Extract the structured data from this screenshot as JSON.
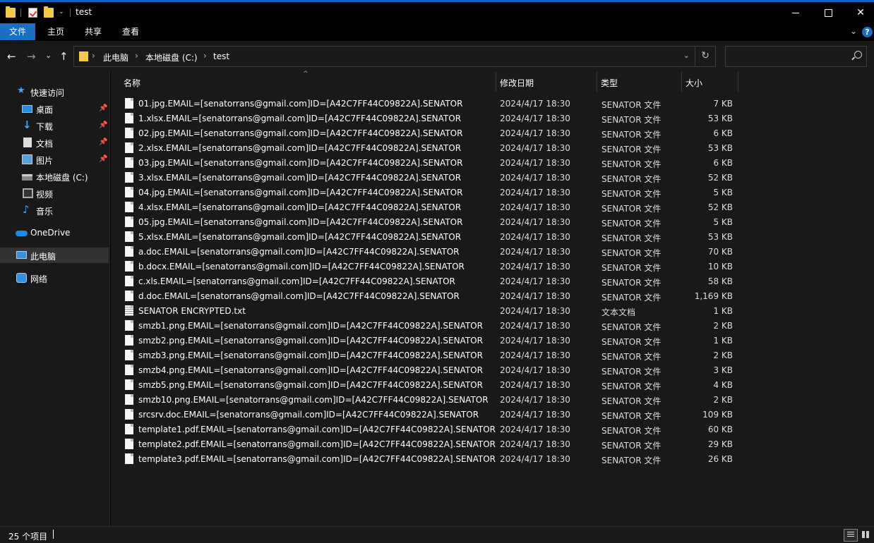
{
  "window": {
    "title": "test",
    "close_glyph": "✕",
    "chevron_glyph": "⌄",
    "help_glyph": "?"
  },
  "ribbon": {
    "tabs": [
      {
        "label": "文件",
        "active": true
      },
      {
        "label": "主页"
      },
      {
        "label": "共享"
      },
      {
        "label": "查看"
      }
    ]
  },
  "nav": {
    "back_glyph": "←",
    "forward_glyph": "→",
    "recent_glyph": "⌄",
    "up_glyph": "↑"
  },
  "address": {
    "crumbs": [
      "此电脑",
      "本地磁盘 (C:)",
      "test"
    ],
    "separator": "›",
    "dropdown_glyph": "⌄",
    "refresh_glyph": "↻"
  },
  "search": {
    "placeholder": "",
    "value": ""
  },
  "sidebar": {
    "pin_glyph": "📌",
    "items": [
      {
        "label": "快速访问",
        "icon": "star-icon",
        "glyph": "★"
      },
      {
        "label": "桌面",
        "icon": "desktop-icon",
        "pinned": true
      },
      {
        "label": "下载",
        "icon": "download-icon",
        "glyph": "↓",
        "pinned": true
      },
      {
        "label": "文档",
        "icon": "document-icon",
        "pinned": true
      },
      {
        "label": "图片",
        "icon": "pictures-icon",
        "pinned": true
      },
      {
        "label": "本地磁盘 (C:)",
        "icon": "drive-icon"
      },
      {
        "label": "视频",
        "icon": "video-icon"
      },
      {
        "label": "音乐",
        "icon": "music-icon",
        "glyph": "♪"
      },
      {
        "label": "OneDrive",
        "icon": "cloud-icon"
      },
      {
        "label": "此电脑",
        "icon": "computer-icon",
        "selected": true
      },
      {
        "label": "网络",
        "icon": "network-icon"
      }
    ]
  },
  "file_list": {
    "sort_glyph": "^",
    "columns": {
      "name": "名称",
      "modified": "修改日期",
      "type": "类型",
      "size": "大小"
    },
    "rows": [
      {
        "name": "01.jpg.EMAIL=[senatorrans@gmail.com]ID=[A42C7FF44C09822A].SENATOR",
        "modified": "2024/4/17 18:30",
        "type": "SENATOR 文件",
        "size": "7 KB"
      },
      {
        "name": "1.xlsx.EMAIL=[senatorrans@gmail.com]ID=[A42C7FF44C09822A].SENATOR",
        "modified": "2024/4/17 18:30",
        "type": "SENATOR 文件",
        "size": "53 KB"
      },
      {
        "name": "02.jpg.EMAIL=[senatorrans@gmail.com]ID=[A42C7FF44C09822A].SENATOR",
        "modified": "2024/4/17 18:30",
        "type": "SENATOR 文件",
        "size": "6 KB"
      },
      {
        "name": "2.xlsx.EMAIL=[senatorrans@gmail.com]ID=[A42C7FF44C09822A].SENATOR",
        "modified": "2024/4/17 18:30",
        "type": "SENATOR 文件",
        "size": "53 KB"
      },
      {
        "name": "03.jpg.EMAIL=[senatorrans@gmail.com]ID=[A42C7FF44C09822A].SENATOR",
        "modified": "2024/4/17 18:30",
        "type": "SENATOR 文件",
        "size": "6 KB"
      },
      {
        "name": "3.xlsx.EMAIL=[senatorrans@gmail.com]ID=[A42C7FF44C09822A].SENATOR",
        "modified": "2024/4/17 18:30",
        "type": "SENATOR 文件",
        "size": "52 KB"
      },
      {
        "name": "04.jpg.EMAIL=[senatorrans@gmail.com]ID=[A42C7FF44C09822A].SENATOR",
        "modified": "2024/4/17 18:30",
        "type": "SENATOR 文件",
        "size": "5 KB"
      },
      {
        "name": "4.xlsx.EMAIL=[senatorrans@gmail.com]ID=[A42C7FF44C09822A].SENATOR",
        "modified": "2024/4/17 18:30",
        "type": "SENATOR 文件",
        "size": "52 KB"
      },
      {
        "name": "05.jpg.EMAIL=[senatorrans@gmail.com]ID=[A42C7FF44C09822A].SENATOR",
        "modified": "2024/4/17 18:30",
        "type": "SENATOR 文件",
        "size": "5 KB"
      },
      {
        "name": "5.xlsx.EMAIL=[senatorrans@gmail.com]ID=[A42C7FF44C09822A].SENATOR",
        "modified": "2024/4/17 18:30",
        "type": "SENATOR 文件",
        "size": "53 KB"
      },
      {
        "name": "a.doc.EMAIL=[senatorrans@gmail.com]ID=[A42C7FF44C09822A].SENATOR",
        "modified": "2024/4/17 18:30",
        "type": "SENATOR 文件",
        "size": "70 KB"
      },
      {
        "name": "b.docx.EMAIL=[senatorrans@gmail.com]ID=[A42C7FF44C09822A].SENATOR",
        "modified": "2024/4/17 18:30",
        "type": "SENATOR 文件",
        "size": "10 KB"
      },
      {
        "name": "c.xls.EMAIL=[senatorrans@gmail.com]ID=[A42C7FF44C09822A].SENATOR",
        "modified": "2024/4/17 18:30",
        "type": "SENATOR 文件",
        "size": "58 KB"
      },
      {
        "name": "d.doc.EMAIL=[senatorrans@gmail.com]ID=[A42C7FF44C09822A].SENATOR",
        "modified": "2024/4/17 18:30",
        "type": "SENATOR 文件",
        "size": "1,169 KB"
      },
      {
        "name": "SENATOR ENCRYPTED.txt",
        "modified": "2024/4/17 18:30",
        "type": "文本文档",
        "size": "1 KB",
        "icon": "text-file-icon"
      },
      {
        "name": "smzb1.png.EMAIL=[senatorrans@gmail.com]ID=[A42C7FF44C09822A].SENATOR",
        "modified": "2024/4/17 18:30",
        "type": "SENATOR 文件",
        "size": "2 KB"
      },
      {
        "name": "smzb2.png.EMAIL=[senatorrans@gmail.com]ID=[A42C7FF44C09822A].SENATOR",
        "modified": "2024/4/17 18:30",
        "type": "SENATOR 文件",
        "size": "1 KB"
      },
      {
        "name": "smzb3.png.EMAIL=[senatorrans@gmail.com]ID=[A42C7FF44C09822A].SENATOR",
        "modified": "2024/4/17 18:30",
        "type": "SENATOR 文件",
        "size": "2 KB"
      },
      {
        "name": "smzb4.png.EMAIL=[senatorrans@gmail.com]ID=[A42C7FF44C09822A].SENATOR",
        "modified": "2024/4/17 18:30",
        "type": "SENATOR 文件",
        "size": "3 KB"
      },
      {
        "name": "smzb5.png.EMAIL=[senatorrans@gmail.com]ID=[A42C7FF44C09822A].SENATOR",
        "modified": "2024/4/17 18:30",
        "type": "SENATOR 文件",
        "size": "4 KB"
      },
      {
        "name": "smzb10.png.EMAIL=[senatorrans@gmail.com]ID=[A42C7FF44C09822A].SENATOR",
        "modified": "2024/4/17 18:30",
        "type": "SENATOR 文件",
        "size": "2 KB"
      },
      {
        "name": "srcsrv.doc.EMAIL=[senatorrans@gmail.com]ID=[A42C7FF44C09822A].SENATOR",
        "modified": "2024/4/17 18:30",
        "type": "SENATOR 文件",
        "size": "109 KB"
      },
      {
        "name": "template1.pdf.EMAIL=[senatorrans@gmail.com]ID=[A42C7FF44C09822A].SENATOR",
        "modified": "2024/4/17 18:30",
        "type": "SENATOR 文件",
        "size": "60 KB"
      },
      {
        "name": "template2.pdf.EMAIL=[senatorrans@gmail.com]ID=[A42C7FF44C09822A].SENATOR",
        "modified": "2024/4/17 18:30",
        "type": "SENATOR 文件",
        "size": "29 KB"
      },
      {
        "name": "template3.pdf.EMAIL=[senatorrans@gmail.com]ID=[A42C7FF44C09822A].SENATOR",
        "modified": "2024/4/17 18:30",
        "type": "SENATOR 文件",
        "size": "26 KB"
      }
    ]
  },
  "status": {
    "item_count": "25 个项目"
  },
  "colors": {
    "accent": "#1a6fc2",
    "background": "#191919",
    "titlebar": "#000000"
  }
}
